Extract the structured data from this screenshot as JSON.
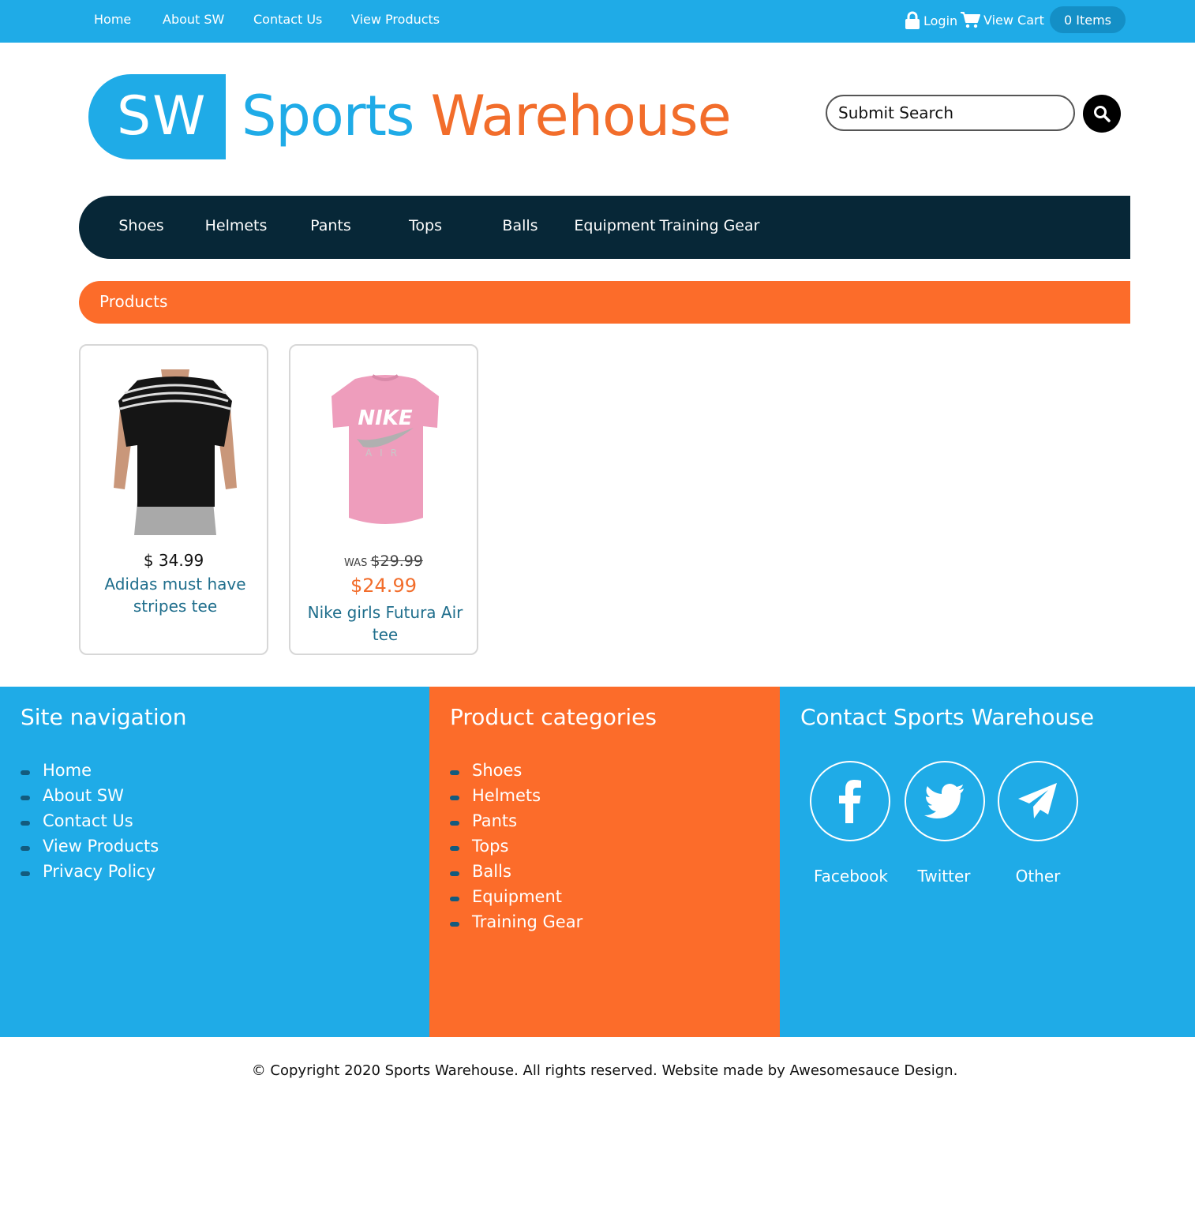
{
  "topnav": {
    "links": [
      "Home",
      "About SW",
      "Contact Us",
      "View Products"
    ],
    "login": "Login",
    "view_cart": "View Cart",
    "items": "0 Items"
  },
  "logo": {
    "badge": "SW",
    "word1": "Sports",
    "word2": "Warehouse"
  },
  "search": {
    "placeholder": "Submit Search"
  },
  "categories": [
    "Shoes",
    "Helmets",
    "Pants",
    "Tops",
    "Balls",
    "Equipment",
    "Training Gear"
  ],
  "section_title": "Products",
  "products": [
    {
      "price": "$ 34.99",
      "name": "Adidas must have stripes tee"
    },
    {
      "was_label": "WAS",
      "was_price": "$29.99",
      "sale_price": "$24.99",
      "name": "Nike girls Futura Air tee",
      "print_text": "NIKE",
      "print_text2": "AIR"
    }
  ],
  "footer": {
    "site_nav_title": "Site navigation",
    "site_nav": [
      "Home",
      "About SW",
      "Contact Us",
      "View Products",
      "Privacy Policy"
    ],
    "categories_title": "Product categories",
    "categories": [
      "Shoes",
      "Helmets",
      "Pants",
      "Tops",
      "Balls",
      "Equipment",
      "Training Gear"
    ],
    "contact_title": "Contact Sports Warehouse",
    "social": [
      "Facebook",
      "Twitter",
      "Other"
    ]
  },
  "copyright": "© Copyright 2020 Sports Warehouse. All rights reserved. Website made by Awesomesauce Design.",
  "colors": {
    "blue": "#1fabe7",
    "orange": "#fc6c2a",
    "navy": "#072737",
    "link_teal": "#1f6e8c"
  }
}
